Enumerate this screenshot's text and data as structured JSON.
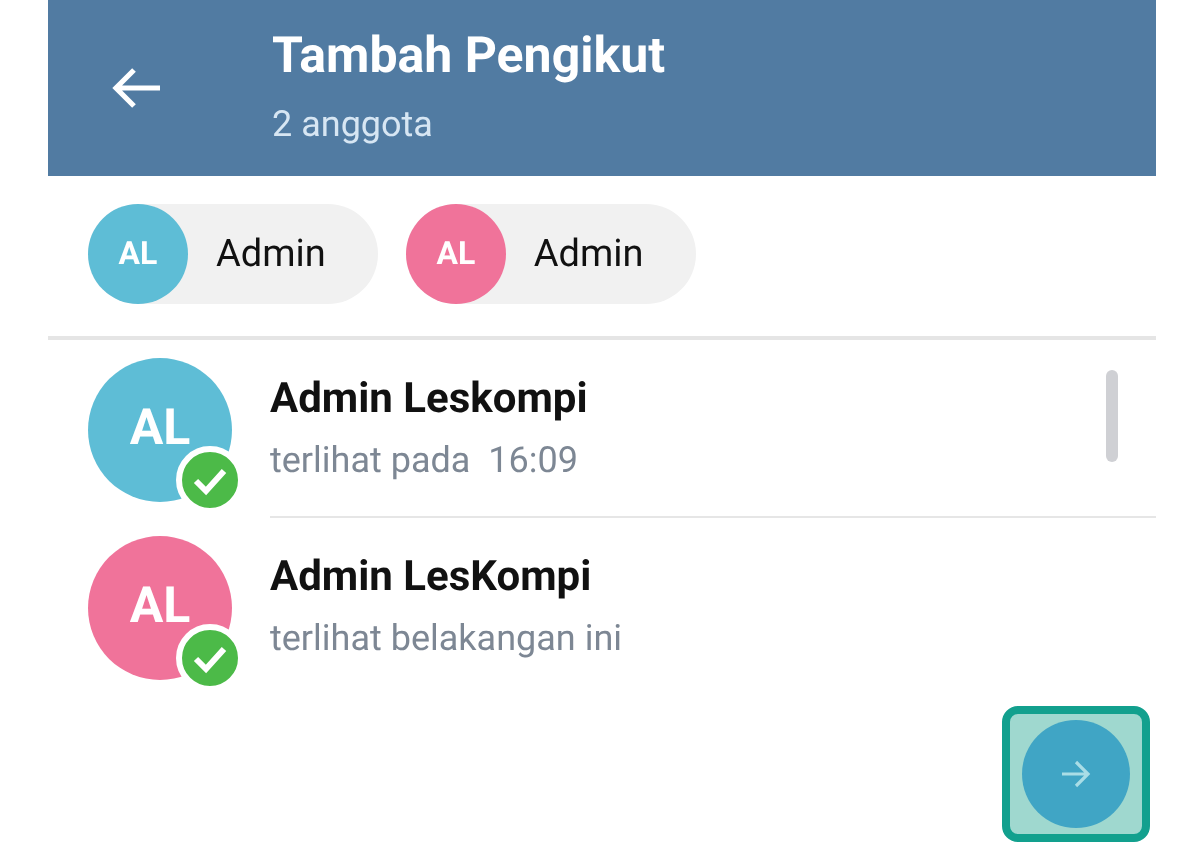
{
  "header": {
    "title": "Tambah Pengikut",
    "subtitle": "2 anggota"
  },
  "chips": [
    {
      "initials": "AL",
      "name": "Admin",
      "color": "#5ebdd6"
    },
    {
      "initials": "AL",
      "name": "Admin",
      "color": "#f0739a"
    }
  ],
  "members": [
    {
      "initials": "AL",
      "name": "Admin Leskompi",
      "status": "terlihat pada  16:09",
      "color": "#5ebdd6",
      "checked": true
    },
    {
      "initials": "AL",
      "name": "Admin LesKompi",
      "status": "terlihat belakangan ini",
      "color": "#f0739a",
      "checked": true
    }
  ]
}
